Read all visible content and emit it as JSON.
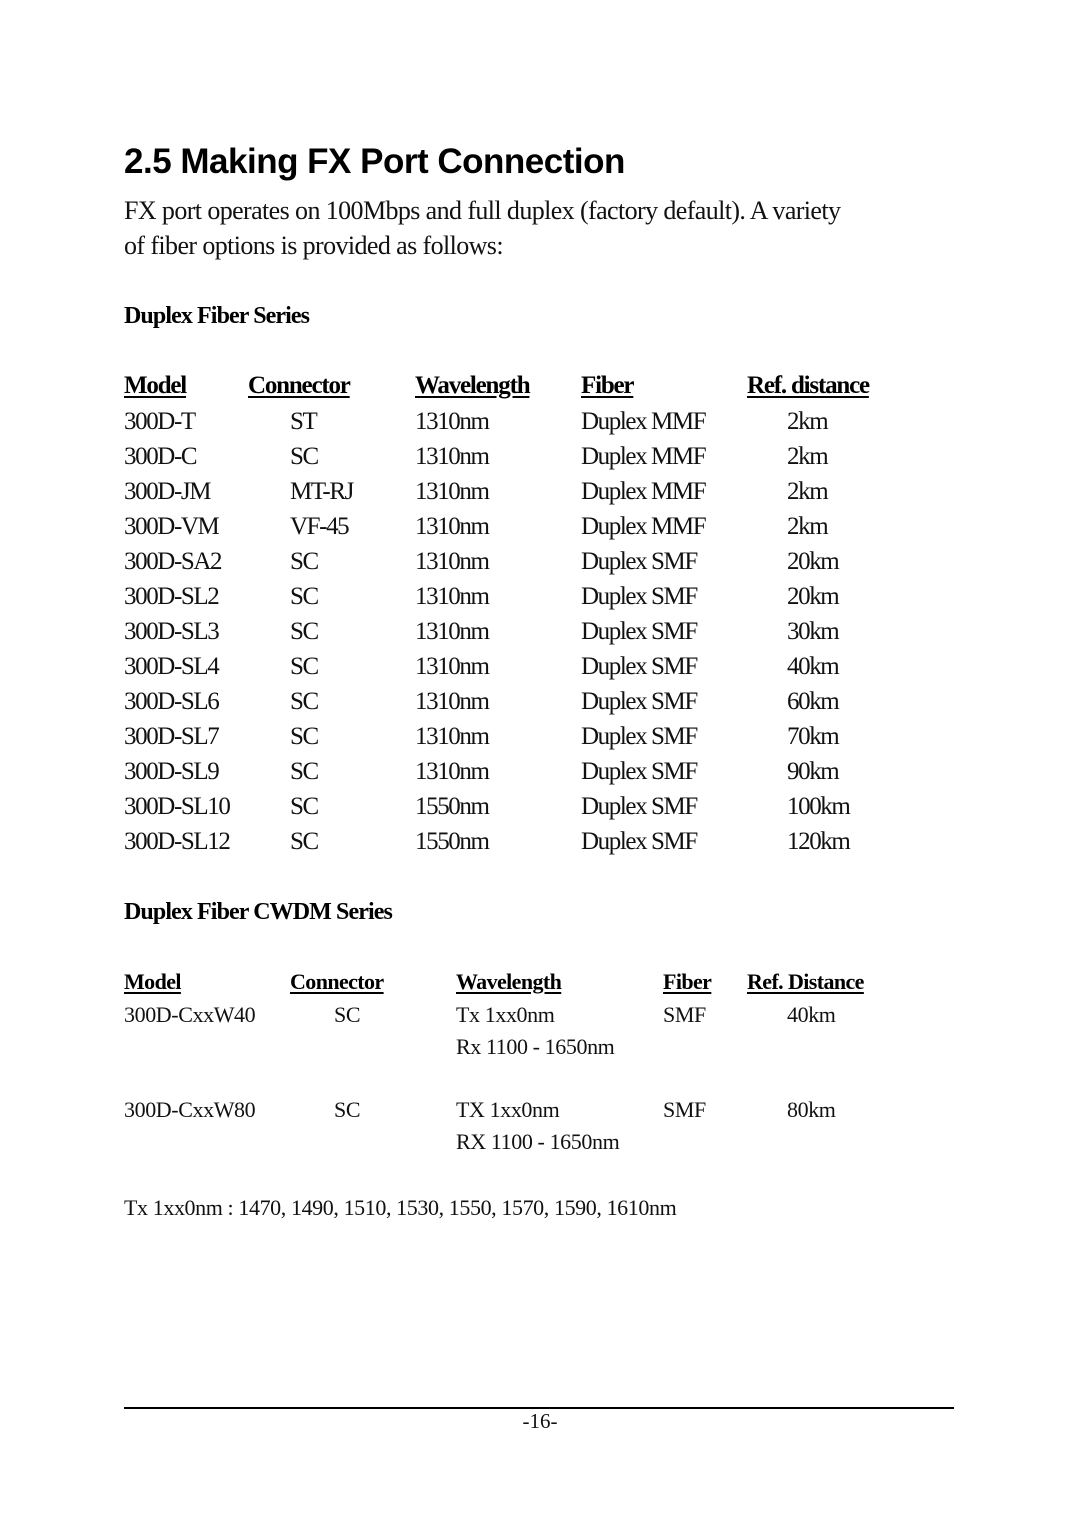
{
  "heading": "2.5 Making FX Port Connection",
  "intro": {
    "line1": "FX port operates on 100Mbps and full duplex (factory default). A variety",
    "line2": "of fiber options is provided as follows:"
  },
  "duplex_series": {
    "title": "Duplex Fiber Series",
    "headers": [
      "Model",
      "Connector",
      "Wavelength",
      "Fiber",
      "Ref. distance"
    ],
    "rows": [
      [
        "300D-T",
        "ST",
        "1310nm",
        "Duplex MMF",
        "2km"
      ],
      [
        "300D-C",
        "SC",
        "1310nm",
        "Duplex MMF",
        "2km"
      ],
      [
        "300D-JM",
        "MT-RJ",
        "1310nm",
        "Duplex MMF",
        "2km"
      ],
      [
        "300D-VM",
        "VF-45",
        "1310nm",
        "Duplex MMF",
        "2km"
      ],
      [
        "300D-SA2",
        "SC",
        "1310nm",
        "Duplex SMF",
        "20km"
      ],
      [
        "300D-SL2",
        "SC",
        "1310nm",
        "Duplex SMF",
        "20km"
      ],
      [
        "300D-SL3",
        "SC",
        "1310nm",
        "Duplex SMF",
        "30km"
      ],
      [
        "300D-SL4",
        "SC",
        "1310nm",
        "Duplex SMF",
        "40km"
      ],
      [
        "300D-SL6",
        "SC",
        "1310nm",
        "Duplex SMF",
        "60km"
      ],
      [
        "300D-SL7",
        "SC",
        "1310nm",
        "Duplex SMF",
        "70km"
      ],
      [
        "300D-SL9",
        "SC",
        "1310nm",
        "Duplex SMF",
        "90km"
      ],
      [
        "300D-SL10",
        "SC",
        "1550nm",
        "Duplex SMF",
        "100km"
      ],
      [
        "300D-SL12",
        "SC",
        "1550nm",
        "Duplex SMF",
        "120km"
      ]
    ]
  },
  "cwdm_series": {
    "title": "Duplex Fiber CWDM Series",
    "headers": [
      "Model",
      "Connector",
      "Wavelength",
      "Fiber",
      "Ref. Distance"
    ],
    "rows": [
      {
        "model": "300D-CxxW40",
        "connector": "SC",
        "tx": "Tx  1xx0nm",
        "rx": "Rx 1100 - 1650nm",
        "fiber": "SMF",
        "distance": "40km"
      },
      {
        "model": "300D-CxxW80",
        "connector": "SC",
        "tx": "TX 1xx0nm",
        "rx": "RX 1100 - 1650nm",
        "fiber": "SMF",
        "distance": "80km"
      }
    ],
    "note": "Tx 1xx0nm : 1470, 1490, 1510, 1530, 1550, 1570, 1590, 1610nm"
  },
  "footer": {
    "page_number": "-16-"
  }
}
